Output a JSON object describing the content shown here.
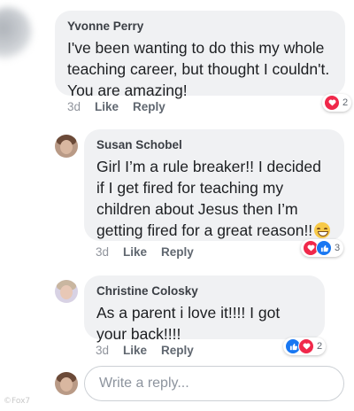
{
  "comments": [
    {
      "name": "Yvonne Perry",
      "text": "I've been wanting to do this my whole teaching career, but thought I couldn't. You are amazing!",
      "time": "3d",
      "like_label": "Like",
      "reply_label": "Reply",
      "reactions": [
        "love"
      ],
      "reaction_count": "2"
    },
    {
      "name": "Susan Schobel",
      "text": "Girl I’m a rule breaker!! I decided if I get fired for teaching my children about Jesus then I’m getting fired for a great reason!!",
      "time": "3d",
      "like_label": "Like",
      "reply_label": "Reply",
      "reactions": [
        "love",
        "like"
      ],
      "reaction_count": "3"
    },
    {
      "name": "Christine Colosky",
      "text": "As a parent i love it!!!! I got your back!!!!",
      "time": "3d",
      "like_label": "Like",
      "reply_label": "Reply",
      "reactions": [
        "like",
        "love"
      ],
      "reaction_count": "2"
    }
  ],
  "reply_box": {
    "placeholder": "Write a reply..."
  },
  "watermark": "©Fox7",
  "colors": {
    "bubble": "#f0f1f3",
    "love": "#f0284a",
    "like": "#1877f2"
  }
}
